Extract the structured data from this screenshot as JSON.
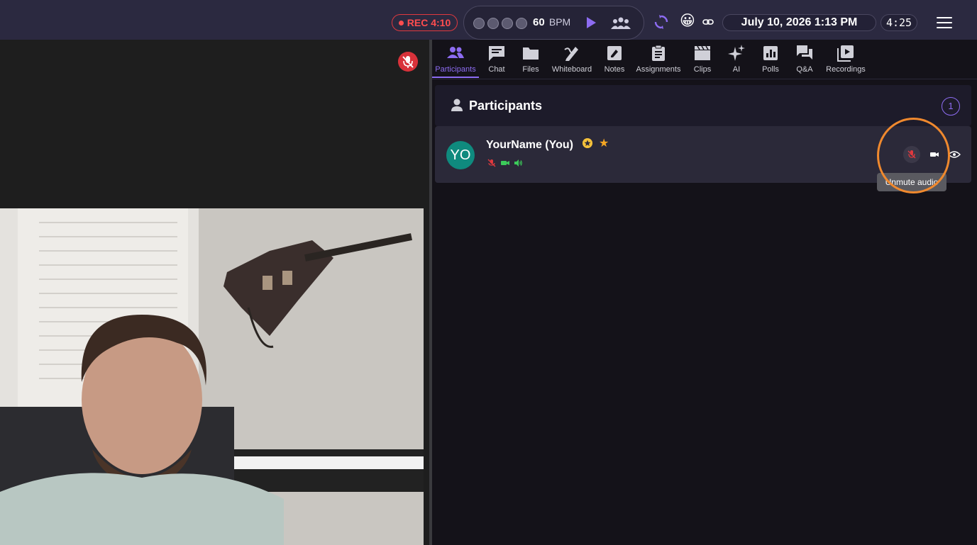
{
  "topbar": {
    "rec_label": "REC 4:10",
    "metronome": {
      "bpm": "60",
      "bpm_unit": "BPM",
      "beats": 4
    },
    "emoji": "😀",
    "datetime": "July 10, 2026 1:13 PM",
    "timer": "4:25"
  },
  "tabs": [
    {
      "label": "Participants",
      "icon": "participants-icon",
      "active": true
    },
    {
      "label": "Chat",
      "icon": "chat-icon"
    },
    {
      "label": "Files",
      "icon": "folder-icon"
    },
    {
      "label": "Whiteboard",
      "icon": "whiteboard-icon"
    },
    {
      "label": "Notes",
      "icon": "notes-icon"
    },
    {
      "label": "Assignments",
      "icon": "clipboard-icon"
    },
    {
      "label": "Clips",
      "icon": "clapperboard-icon"
    },
    {
      "label": "AI",
      "icon": "sparkle-icon"
    },
    {
      "label": "Polls",
      "icon": "poll-icon"
    },
    {
      "label": "Q&A",
      "icon": "qa-icon"
    },
    {
      "label": "Recordings",
      "icon": "recordings-icon"
    }
  ],
  "participants": {
    "title": "Participants",
    "count": "1",
    "list": [
      {
        "initials": "YO",
        "name": "YourName (You)",
        "avatar_color": "#0f8a7e"
      }
    ]
  },
  "tooltip": "Unmute audio",
  "colors": {
    "accent": "#8d6cf2",
    "rec": "#ff4d4f",
    "highlight": "#f0892e",
    "muted": "#d8323a",
    "active_green": "#3ccb5a"
  }
}
